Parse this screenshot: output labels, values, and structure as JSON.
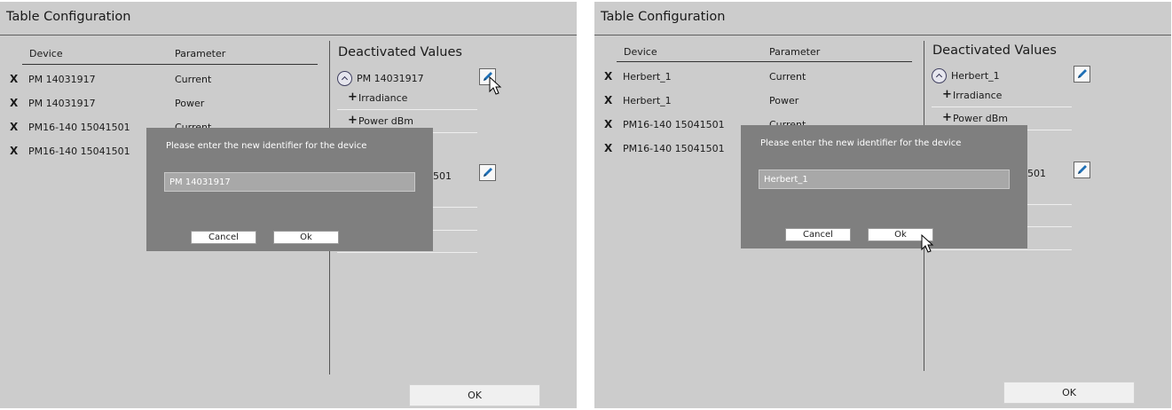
{
  "colors": {
    "panel_bg": "#cccccc",
    "dialog_bg": "#7f7f7f",
    "input_bg": "#a8a8a8",
    "edit_icon": "#1e6fb5"
  },
  "panels": [
    {
      "title": "Table Configuration",
      "columns": {
        "device": "Device",
        "parameter": "Parameter"
      },
      "rows": [
        {
          "remove": "X",
          "device": "PM 14031917",
          "parameter": "Current"
        },
        {
          "remove": "X",
          "device": "PM 14031917",
          "parameter": "Power"
        },
        {
          "remove": "X",
          "device": "PM16-140 15041501",
          "parameter": "Current"
        },
        {
          "remove": "X",
          "device": "PM16-140 15041501",
          "parameter": ""
        }
      ],
      "deactivated": {
        "title": "Deactivated Values",
        "group": "PM 14031917",
        "items": [
          {
            "add": "+",
            "label": "Irradiance"
          },
          {
            "add": "+",
            "label": "Power dBm"
          }
        ],
        "partial_label": "501"
      },
      "ok_label": "OK",
      "dialog": {
        "prompt": "Please enter the new identifier for the device",
        "value": "PM 14031917",
        "cancel_label": "Cancel",
        "ok_label": "Ok"
      }
    },
    {
      "title": "Table Configuration",
      "columns": {
        "device": "Device",
        "parameter": "Parameter"
      },
      "rows": [
        {
          "remove": "X",
          "device": "Herbert_1",
          "parameter": "Current"
        },
        {
          "remove": "X",
          "device": "Herbert_1",
          "parameter": "Power"
        },
        {
          "remove": "X",
          "device": "PM16-140 15041501",
          "parameter": "Current"
        },
        {
          "remove": "X",
          "device": "PM16-140 15041501",
          "parameter": ""
        }
      ],
      "deactivated": {
        "title": "Deactivated Values",
        "group": "Herbert_1",
        "items": [
          {
            "add": "+",
            "label": "Irradiance"
          },
          {
            "add": "+",
            "label": "Power dBm"
          }
        ],
        "partial_label": "501"
      },
      "ok_label": "OK",
      "dialog": {
        "prompt": "Please enter the new identifier for the device",
        "value": "Herbert_1",
        "cancel_label": "Cancel",
        "ok_label": "Ok"
      }
    }
  ]
}
